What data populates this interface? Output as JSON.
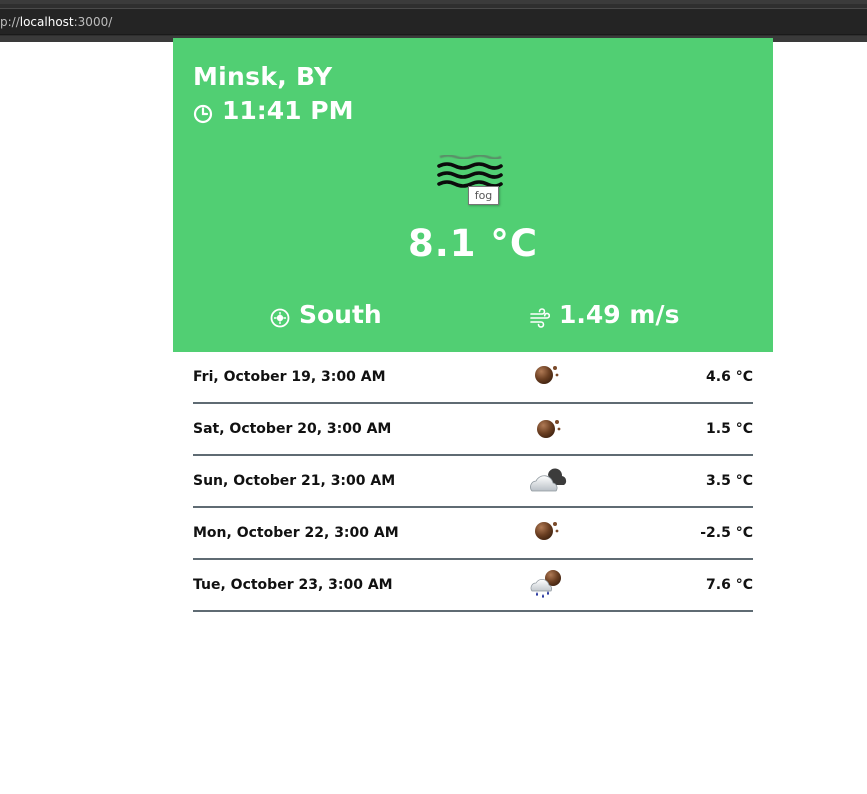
{
  "browser": {
    "url_prefix": "p://",
    "url_host": "localhost",
    "url_rest": ":3000/"
  },
  "current": {
    "city": "Minsk, BY",
    "time": "11:41 PM",
    "condition_tooltip": "fog",
    "temperature": "8.1 °C",
    "wind_direction": "South",
    "wind_speed": "1.49 m/s",
    "icons": {
      "clock": "clock-icon",
      "weather": "fog-icon",
      "compass": "compass-icon",
      "wind": "wind-icon"
    }
  },
  "forecast": [
    {
      "date": "Fri, October 19, 3:00 AM",
      "temperature": "4.6 °C",
      "icon": "moon-icon"
    },
    {
      "date": "Sat, October 20, 3:00 AM",
      "temperature": "1.5 °C",
      "icon": "moon-icon"
    },
    {
      "date": "Sun, October 21, 3:00 AM",
      "temperature": "3.5 °C",
      "icon": "cloudy-night-icon"
    },
    {
      "date": "Mon, October 22, 3:00 AM",
      "temperature": "-2.5 °C",
      "icon": "moon-icon"
    },
    {
      "date": "Tue, October 23, 3:00 AM",
      "temperature": "7.6 °C",
      "icon": "rain-night-icon"
    }
  ],
  "colors": {
    "card_background": "#51cf73",
    "card_text": "#ffffff",
    "divider": "#5f6b73"
  }
}
